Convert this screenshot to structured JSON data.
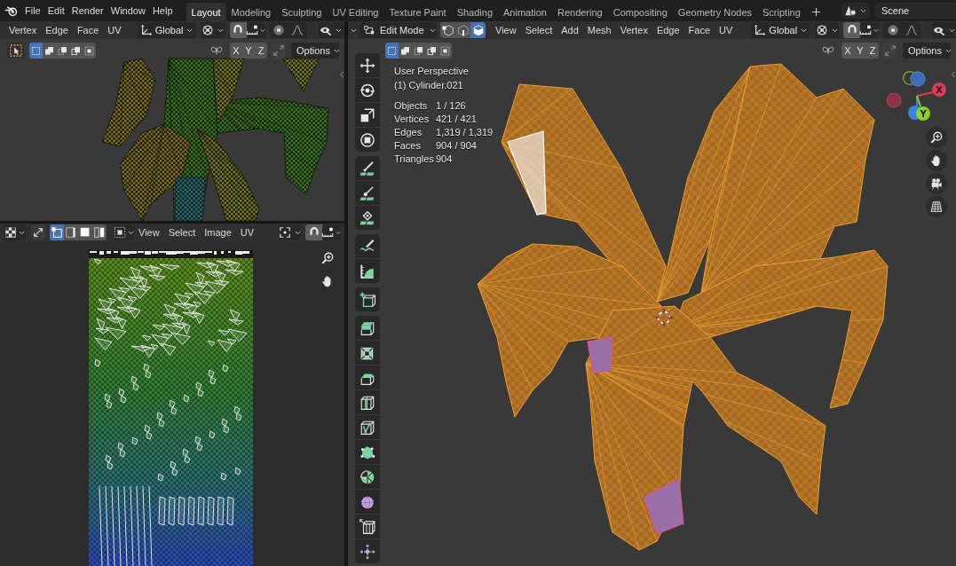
{
  "top_bar": {
    "menus": [
      "File",
      "Edit",
      "Render",
      "Window",
      "Help"
    ],
    "workspaces": [
      {
        "label": "Layout",
        "selected": true
      },
      {
        "label": "Modeling",
        "selected": false
      },
      {
        "label": "Sculpting",
        "selected": false
      },
      {
        "label": "UV Editing",
        "selected": false
      },
      {
        "label": "Texture Paint",
        "selected": false
      },
      {
        "label": "Shading",
        "selected": false
      },
      {
        "label": "Animation",
        "selected": false
      },
      {
        "label": "Rendering",
        "selected": false
      },
      {
        "label": "Compositing",
        "selected": false
      },
      {
        "label": "Geometry Nodes",
        "selected": false
      },
      {
        "label": "Scripting",
        "selected": false
      }
    ],
    "scene": "Scene"
  },
  "top_left_viewport": {
    "menus": [
      "Vertex",
      "Edge",
      "Face",
      "UV"
    ],
    "orientation": "Global",
    "selection_modes": [
      {
        "selected": true
      },
      {
        "selected": false
      },
      {
        "selected": false
      },
      {
        "selected": false
      },
      {
        "selected": false
      }
    ],
    "mirror_axes": [
      {
        "label": "X",
        "on": false
      },
      {
        "label": "Y",
        "on": false
      },
      {
        "label": "Z",
        "on": false
      }
    ],
    "options": "Options"
  },
  "uv_editor": {
    "uv_select_modes": [
      {
        "selected": true
      },
      {
        "selected": false
      },
      {
        "selected": false
      },
      {
        "selected": false
      }
    ],
    "menus": [
      "View",
      "Select",
      "Image",
      "UV"
    ]
  },
  "viewport": {
    "mode": "Edit Mode",
    "mesh_select_modes": [
      {
        "selected": false
      },
      {
        "selected": false
      },
      {
        "selected": true
      }
    ],
    "menus": [
      "View",
      "Select",
      "Add",
      "Mesh",
      "Vertex",
      "Edge",
      "Face",
      "UV"
    ],
    "orientation": "Global",
    "selection_modes": [
      {
        "selected": true
      },
      {
        "selected": false
      },
      {
        "selected": false
      },
      {
        "selected": false
      },
      {
        "selected": false
      }
    ],
    "mirror_axes": [
      {
        "label": "X",
        "on": false
      },
      {
        "label": "Y",
        "on": false
      },
      {
        "label": "Z",
        "on": false
      }
    ],
    "options": "Options",
    "overlay": {
      "view": "User Perspective",
      "object": "(1) Cylinder.021",
      "stats": [
        {
          "label": "Objects",
          "value": "1 / 126"
        },
        {
          "label": "Vertices",
          "value": "421 / 421"
        },
        {
          "label": "Edges",
          "value": "1,319 / 1,319"
        },
        {
          "label": "Faces",
          "value": "904 / 904"
        },
        {
          "label": "Triangles",
          "value": "904"
        }
      ]
    },
    "gizmo": {
      "x": "X",
      "y": "Y"
    }
  }
}
